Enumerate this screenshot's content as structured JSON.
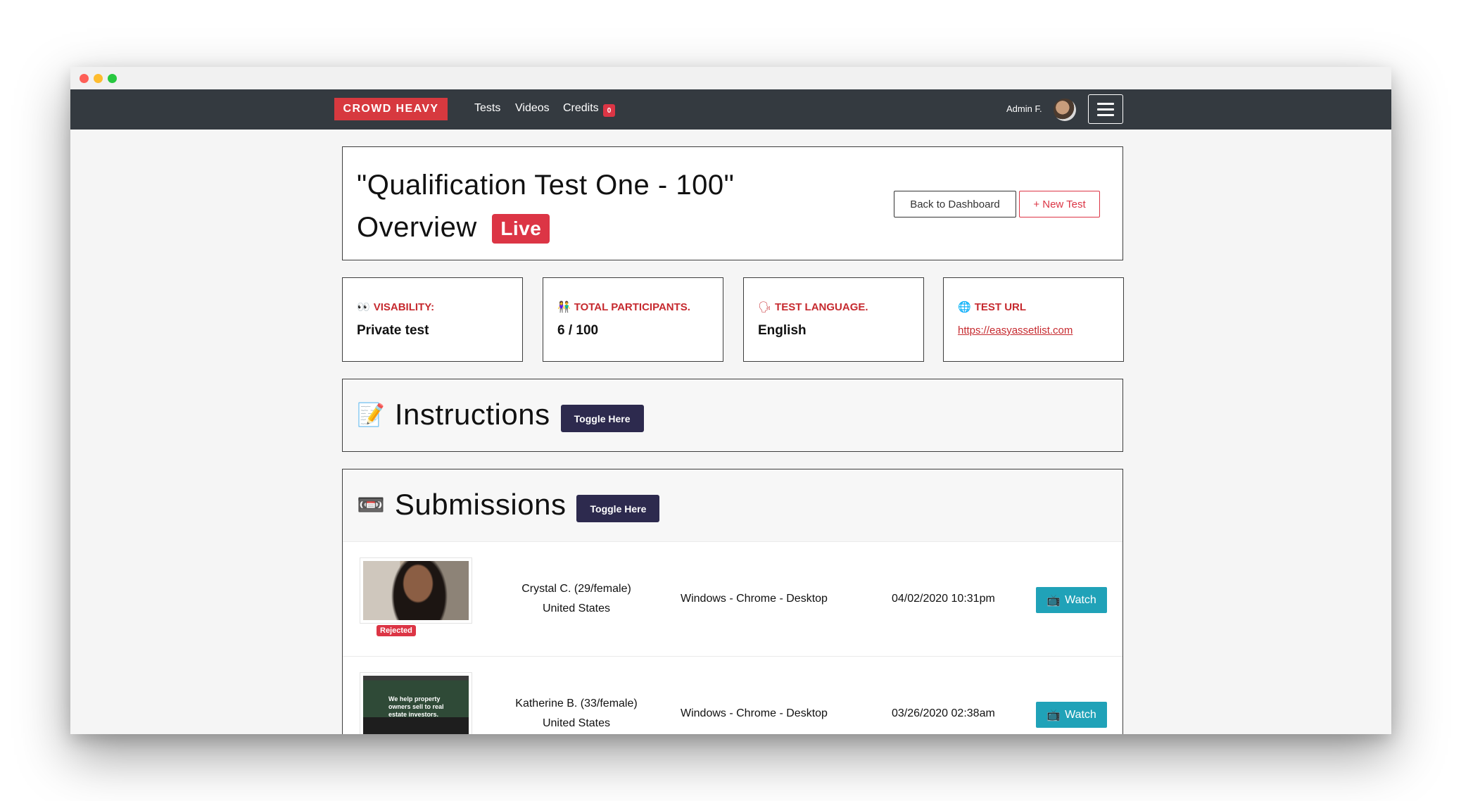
{
  "navbar": {
    "brand": "CROWD HEAVY",
    "links": [
      "Tests",
      "Videos",
      "Credits"
    ],
    "credits_badge": "0",
    "admin_name": "Admin F."
  },
  "header": {
    "title_line1": "\"Qualification Test One - 100\"",
    "title_line2": "Overview",
    "live_badge": "Live",
    "back_button": "Back to Dashboard",
    "new_test_button": "+ New Test"
  },
  "stats": [
    {
      "icon": "eyes-icon",
      "emoji": "👀",
      "label": "VISABILITY:",
      "value": "Private test"
    },
    {
      "icon": "people-icon",
      "emoji": "👫",
      "label": "TOTAL PARTICIPANTS.",
      "value": "6 / 100"
    },
    {
      "icon": "speaking-head-icon",
      "emoji": "🗣",
      "label": "TEST LANGUAGE.",
      "value": "English"
    },
    {
      "icon": "globe-icon",
      "emoji": "🌐",
      "label": "TEST URL",
      "link": "https://easyassetlist.com"
    }
  ],
  "instructions": {
    "icon": "memo-icon",
    "emoji": "📝",
    "title": "Instructions",
    "toggle": "Toggle Here"
  },
  "submissions": {
    "icon": "videocassette-icon",
    "emoji": "📼",
    "title": "Submissions",
    "toggle": "Toggle Here",
    "rows": [
      {
        "name": "Crystal C. (29/female)",
        "country": "United States",
        "device": "Windows - Chrome - Desktop",
        "date": "04/02/2020 10:31pm",
        "status": "Rejected",
        "watch": "Watch"
      },
      {
        "name": "Katherine B. (33/female)",
        "country": "United States",
        "device": "Windows - Chrome - Desktop",
        "date": "03/26/2020 02:38am",
        "thumb_text": "We help property owners sell to real estate investors.",
        "watch": "Watch"
      }
    ]
  },
  "colors": {
    "brand": "#d7393f",
    "navbar": "#343a40",
    "toggle": "#2d2a4e",
    "watch": "#20a2b8"
  }
}
